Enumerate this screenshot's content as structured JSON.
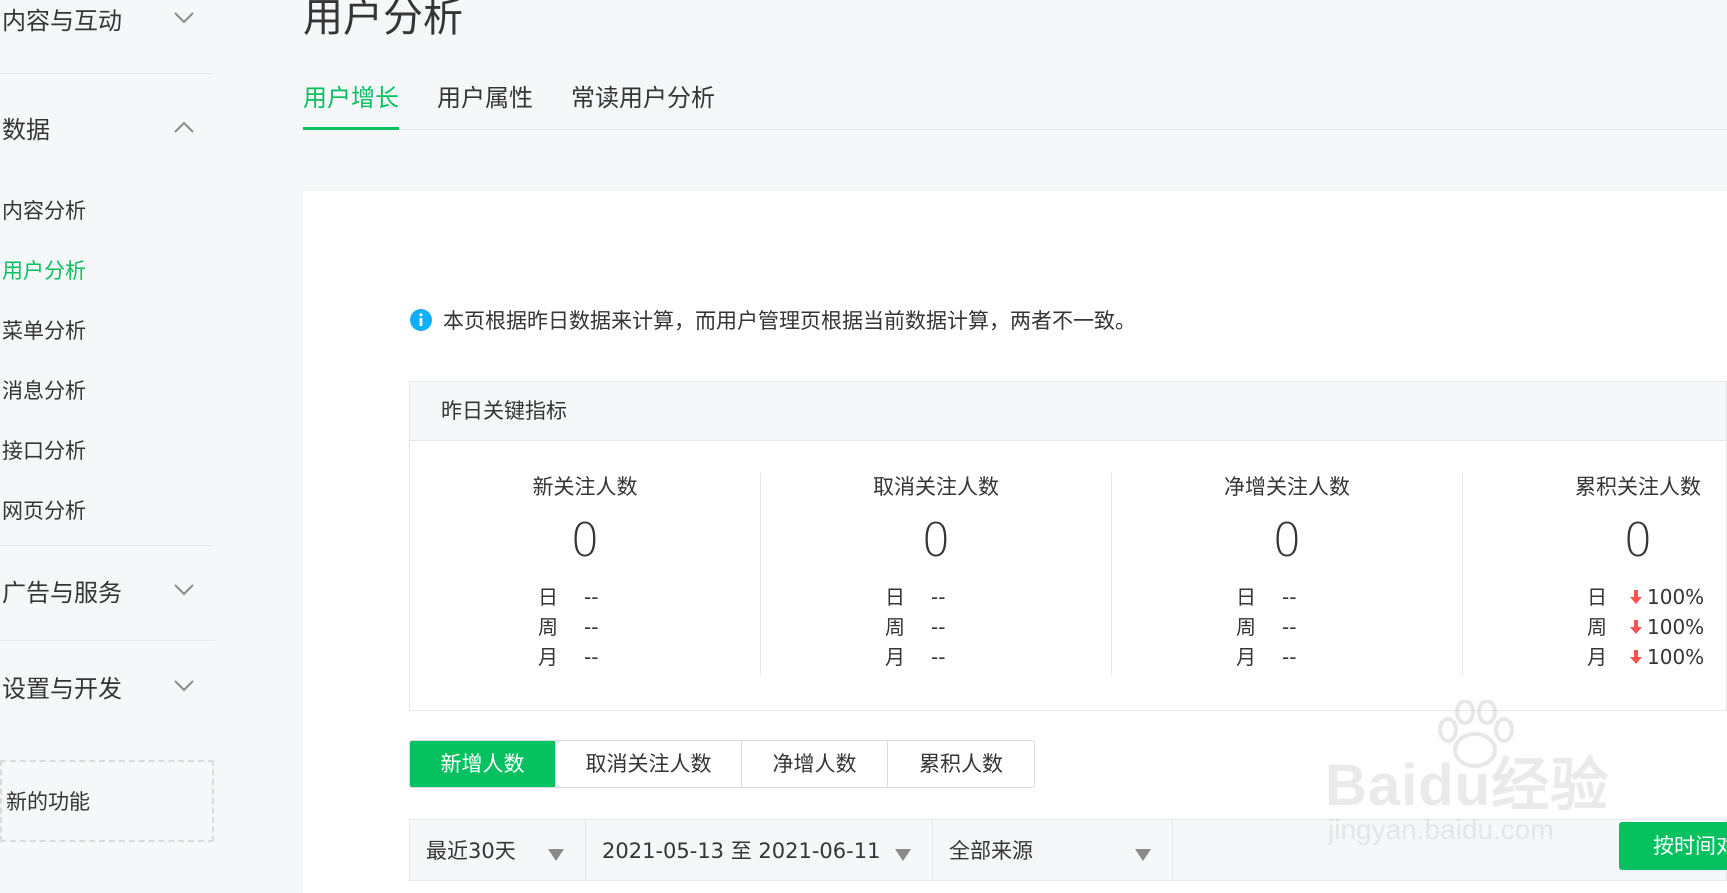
{
  "sidebar": {
    "groups": [
      {
        "label": "内容与互动"
      },
      {
        "label": "数据"
      },
      {
        "label": "广告与服务"
      },
      {
        "label": "设置与开发"
      }
    ],
    "data_items": [
      {
        "label": "内容分析"
      },
      {
        "label": "用户分析"
      },
      {
        "label": "菜单分析"
      },
      {
        "label": "消息分析"
      },
      {
        "label": "接口分析"
      },
      {
        "label": "网页分析"
      }
    ],
    "active_item": "用户分析",
    "new_feature": "新的功能"
  },
  "header": {
    "title": "用户分析",
    "tabs": [
      {
        "label": "用户增长"
      },
      {
        "label": "用户属性"
      },
      {
        "label": "常读用户分析"
      }
    ],
    "active_tab": "用户增长"
  },
  "notice": {
    "icon": "info-icon",
    "text": "本页根据昨日数据来计算，而用户管理页根据当前数据计算，两者不一致。"
  },
  "key_metrics": {
    "title": "昨日关键指标",
    "period_labels": [
      "日",
      "周",
      "月"
    ],
    "metrics": [
      {
        "label": "新关注人数",
        "value": "0",
        "rows": [
          {
            "value": "--"
          },
          {
            "value": "--"
          },
          {
            "value": "--"
          }
        ]
      },
      {
        "label": "取消关注人数",
        "value": "0",
        "rows": [
          {
            "value": "--"
          },
          {
            "value": "--"
          },
          {
            "value": "--"
          }
        ]
      },
      {
        "label": "净增关注人数",
        "value": "0",
        "rows": [
          {
            "value": "--"
          },
          {
            "value": "--"
          },
          {
            "value": "--"
          }
        ]
      },
      {
        "label": "累积关注人数",
        "value": "0",
        "rows": [
          {
            "value": "100%",
            "trend": "down"
          },
          {
            "value": "100%",
            "trend": "down"
          },
          {
            "value": "100%",
            "trend": "down"
          }
        ]
      }
    ]
  },
  "data_tabs": {
    "items": [
      {
        "label": "新增人数"
      },
      {
        "label": "取消关注人数"
      },
      {
        "label": "净增人数"
      },
      {
        "label": "累积人数"
      }
    ],
    "active": "新增人数"
  },
  "filters": {
    "range": "最近30天",
    "dates": "2021-05-13 至 2021-06-11",
    "source": "全部来源",
    "button": "按时间对比"
  },
  "watermark": {
    "main": "Baidu经验",
    "sub": "jingyan.baidu.com"
  },
  "colors": {
    "accent": "#07c160",
    "down_arrow": "#fa5151",
    "info": "#10aeff",
    "text": "#353535",
    "background": "#f6f7f8"
  }
}
